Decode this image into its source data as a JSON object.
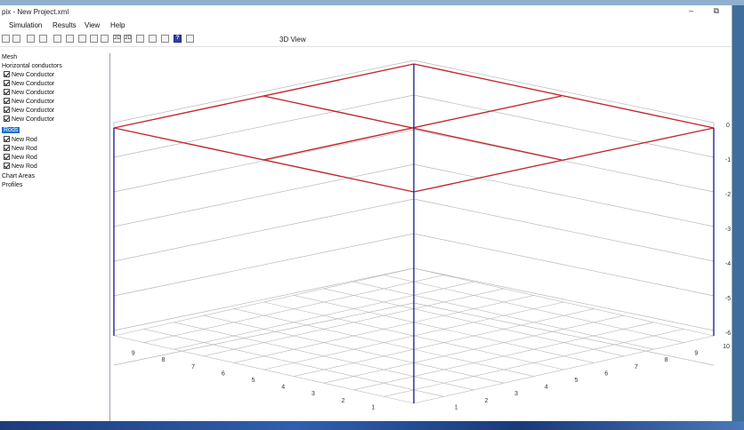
{
  "window": {
    "title": "pix - New Project.xml",
    "controls": "–  ⧉"
  },
  "menu": [
    "Simulation",
    "Results",
    "View",
    "Help"
  ],
  "toolbar": [
    "save-icon",
    "disk-icon",
    "open-icon",
    "edit-icon",
    "arrow-icon",
    "bars-icon",
    "grid-icon",
    "table-icon",
    "rods-icon",
    "2d-plot-icon",
    "2d-alt-icon",
    "chart-icon",
    "surface-icon",
    "chart-edit-icon",
    "help-icon",
    "settings-icon"
  ],
  "toolbar_glyphs": [
    "",
    "",
    "",
    "",
    "",
    "",
    "",
    "",
    "",
    "2D",
    "2D",
    "",
    "",
    "",
    "?",
    ""
  ],
  "view_tab": "3D View",
  "tree": {
    "mesh": "Mesh",
    "horizontal": "Horizontal conductors",
    "conductors": [
      "New Conductor",
      "New Conductor",
      "New Conductor",
      "New Conductor",
      "New Conductor",
      "New Conductor"
    ],
    "rods_label": "Rods",
    "rods": [
      "New Rod",
      "New Rod",
      "New Rod",
      "New Rod"
    ],
    "chart_areas": "Chart Areas",
    "profiles": "Profiles"
  },
  "plot": {
    "z_ticks": [
      "0",
      "-1",
      "-2",
      "-3",
      "-4",
      "-5",
      "-6"
    ],
    "front_right_ticks": [
      "1",
      "2",
      "3",
      "4",
      "5",
      "6",
      "7",
      "8",
      "9",
      "10"
    ],
    "front_left_ticks": [
      "1",
      "2",
      "3",
      "4",
      "5",
      "6",
      "7",
      "8",
      "9"
    ],
    "colors": {
      "conductor": "#c0282c",
      "rod": "#1f2a8a",
      "grid": "#b8b8b8"
    }
  }
}
